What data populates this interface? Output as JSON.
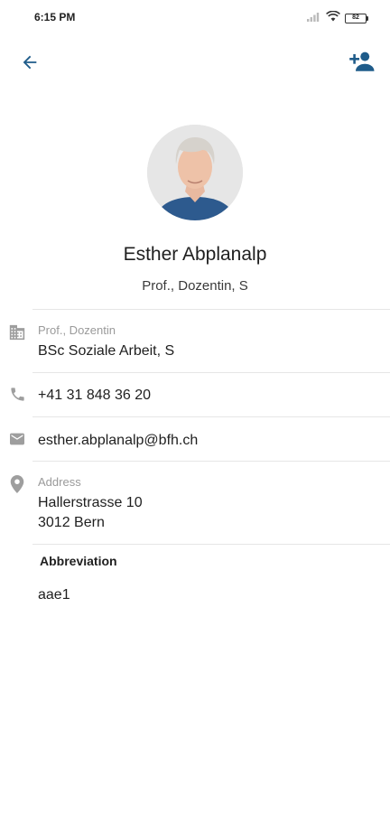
{
  "status_bar": {
    "time": "6:15 PM",
    "battery": "82",
    "signal_icon": "signal-bars-icon",
    "wifi_icon": "wifi-icon"
  },
  "app_bar": {
    "back_icon": "arrow-back-icon",
    "add_contact_icon": "person-add-icon",
    "accent_color": "#1f5c8a"
  },
  "profile": {
    "name": "Esther Abplanalp",
    "subtitle": "Prof., Dozentin, S"
  },
  "details": {
    "organization": {
      "icon": "building-icon",
      "label": "Prof., Dozentin",
      "value": "BSc Soziale Arbeit, S"
    },
    "phone": {
      "icon": "phone-icon",
      "value": "+41 31 848 36 20"
    },
    "email": {
      "icon": "email-icon",
      "value": "esther.abplanalp@bfh.ch"
    },
    "address": {
      "icon": "location-pin-icon",
      "label": "Address",
      "line1": "Hallerstrasse 10",
      "line2": "3012 Bern"
    }
  },
  "abbreviation": {
    "heading": "Abbreviation",
    "value": "aae1"
  }
}
